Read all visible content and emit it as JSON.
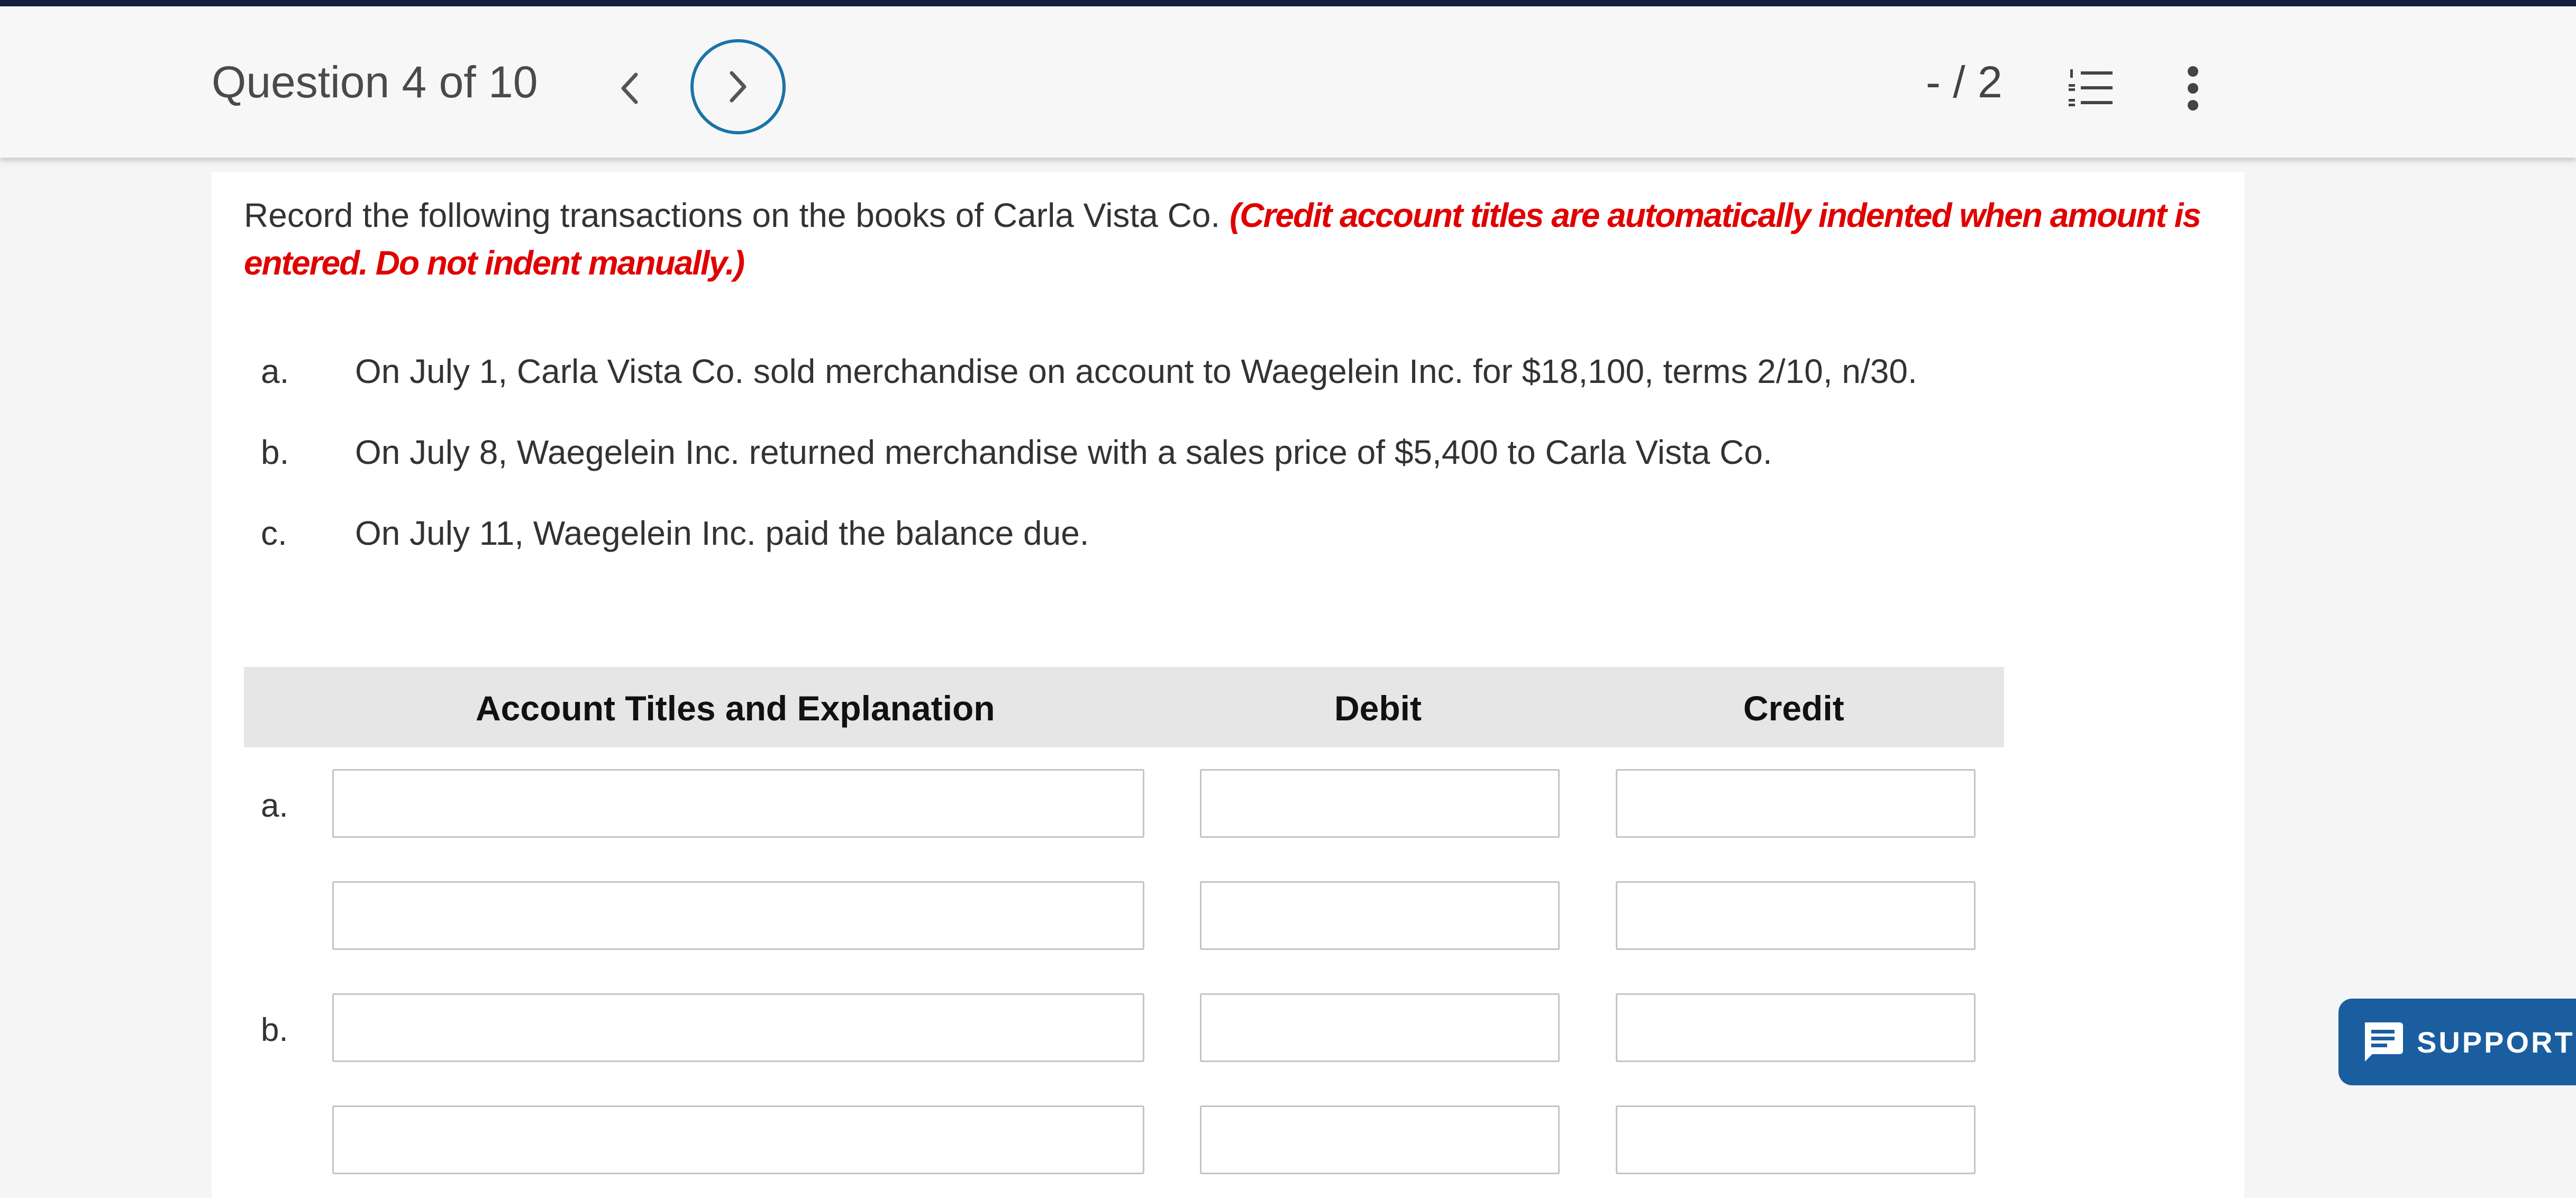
{
  "header": {
    "question_label": "Question 4 of 10",
    "score": "- / 2",
    "prev_icon": "chevron-left-icon",
    "next_icon": "chevron-right-icon",
    "list_icon": "numbered-list-icon",
    "more_icon": "more-vertical-icon"
  },
  "instructions": {
    "text": "Record the following transactions on the books of Carla Vista Co.",
    "note": "(Credit account titles are automatically indented when amount is entered. Do not indent manually.)"
  },
  "transactions": [
    {
      "label": "a.",
      "text": "On July 1, Carla Vista Co. sold merchandise on account to Waegelein Inc. for $18,100, terms 2/10, n/30."
    },
    {
      "label": "b.",
      "text": "On July 8, Waegelein Inc. returned merchandise with a sales price of $5,400 to Carla Vista Co."
    },
    {
      "label": "c.",
      "text": "On July 11, Waegelein Inc. paid the balance due."
    }
  ],
  "table": {
    "headers": [
      "Account Titles and Explanation",
      "Debit",
      "Credit"
    ],
    "row_labels": [
      "a.",
      "b."
    ]
  },
  "support": {
    "label": "SUPPORT",
    "icon": "chat-icon"
  },
  "colors": {
    "accent": "#1a73a8",
    "note_red": "#e00000",
    "support_bg": "#1b5ea0",
    "top_stripe": "#141f3c"
  }
}
